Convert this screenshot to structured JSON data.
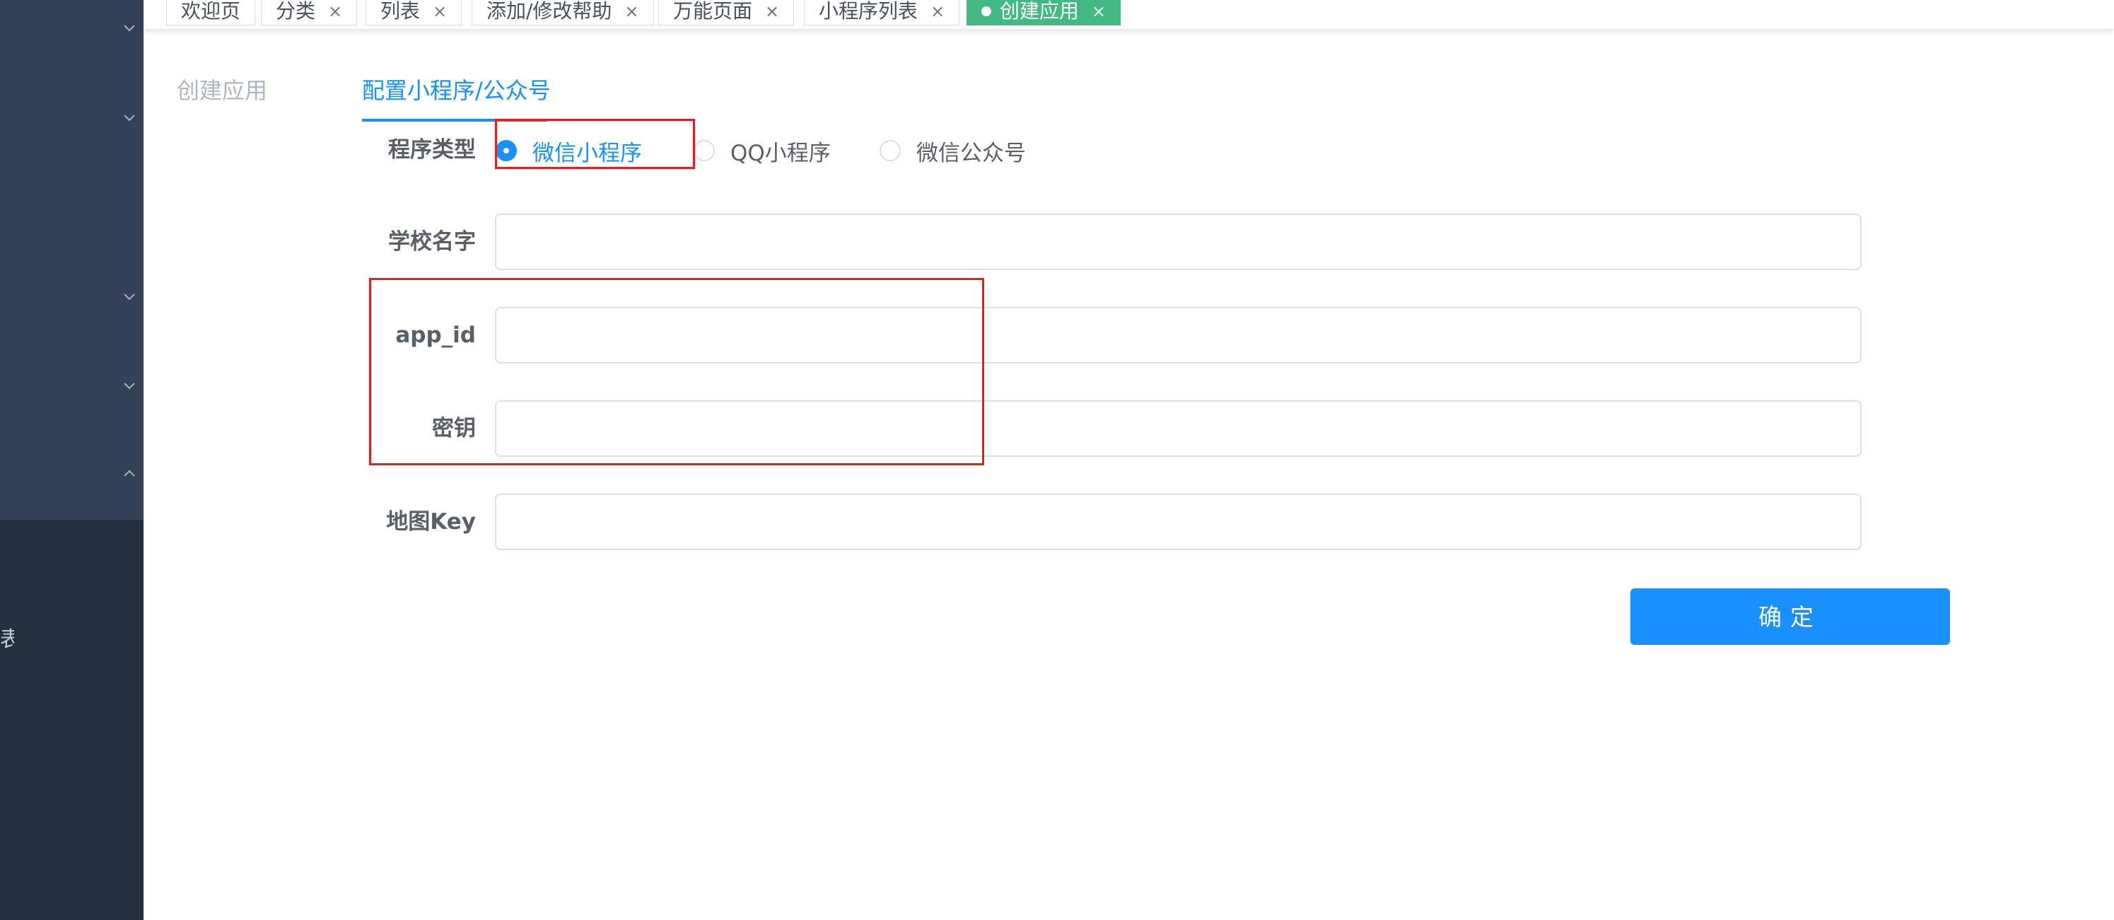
{
  "tags": [
    {
      "label": "欢迎页",
      "closable": false,
      "active": false
    },
    {
      "label": "分类",
      "closable": true,
      "active": false
    },
    {
      "label": "列表",
      "closable": true,
      "active": false
    },
    {
      "label": "添加/修改帮助",
      "closable": true,
      "active": false
    },
    {
      "label": "万能页面",
      "closable": true,
      "active": false
    },
    {
      "label": "小程序列表",
      "closable": true,
      "active": false
    },
    {
      "label": "创建应用",
      "closable": true,
      "active": true
    }
  ],
  "tag_close_glyph": "×",
  "sidebar": {
    "lower_item_label": "表"
  },
  "steps": [
    {
      "label": "创建应用",
      "active": false
    },
    {
      "label": "配置小程序/公众号",
      "active": true
    }
  ],
  "form": {
    "program_type_label": "程序类型",
    "program_type_options": [
      "微信小程序",
      "QQ小程序",
      "微信公众号"
    ],
    "program_type_selected": "微信小程序",
    "school_name_label": "学校名字",
    "school_name_value": "",
    "app_id_label": "app_id",
    "app_id_value": "",
    "secret_label": "密钥",
    "secret_value": "",
    "map_key_label": "地图Key",
    "map_key_value": ""
  },
  "confirm_button_label": "确定",
  "colors": {
    "sidebar_bg": "#243042",
    "sidebar_menu_bg": "#324157",
    "primary": "#1890ff",
    "active_tag": "#42b983",
    "annotation": "#e02020"
  }
}
